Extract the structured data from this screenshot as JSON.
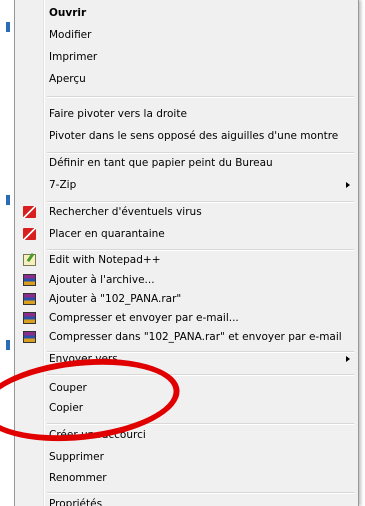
{
  "menu": {
    "group1": [
      "Ouvrir",
      "Modifier",
      "Imprimer",
      "Aperçu"
    ],
    "group2": [
      "Faire pivoter vers la droite",
      "Pivoter dans le sens opposé des aiguilles d'une montre"
    ],
    "group3": [
      "Définir en tant que papier peint du Bureau",
      "7-Zip"
    ],
    "group4": [
      "Rechercher d'éventuels virus",
      "Placer en quarantaine"
    ],
    "group5": [
      "Edit with Notepad++",
      "Ajouter à l'archive...",
      "Ajouter à \"102_PANA.rar\"",
      "Compresser et envoyer par e-mail...",
      "Compresser dans \"102_PANA.rar\" et envoyer par e-mail"
    ],
    "group6": [
      "Envoyer vers"
    ],
    "group7": [
      "Couper",
      "Copier"
    ],
    "group8": [
      "Créer un raccourci",
      "Supprimer",
      "Renommer"
    ],
    "group9": [
      "Propriétés"
    ]
  },
  "icons": {
    "antivirus": "antivirus-icon",
    "notepad": "notepad-plus-plus-icon",
    "rar": "winrar-icon"
  },
  "colors": {
    "highlight_circle": "#e00000",
    "menu_bg": "#f0f0f0"
  }
}
